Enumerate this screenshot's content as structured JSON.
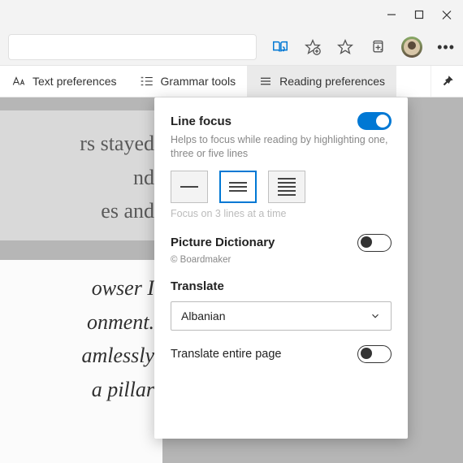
{
  "toolbar": {
    "text_preferences": "Text preferences",
    "grammar_tools": "Grammar tools",
    "reading_preferences": "Reading preferences"
  },
  "background": {
    "block1": "rs stayed\nnd\nes and",
    "block2": "owser I\nonment.\namlessly\na pillar"
  },
  "panel": {
    "line_focus": {
      "title": "Line focus",
      "help": "Helps to focus while reading by highlighting one, three or five lines",
      "hint": "Focus on 3 lines at a time",
      "enabled": true,
      "selected": 1
    },
    "picture_dictionary": {
      "title": "Picture Dictionary",
      "copyright": "© Boardmaker",
      "enabled": false
    },
    "translate": {
      "title": "Translate",
      "selected": "Albanian",
      "entire_page_label": "Translate entire page",
      "entire_page_enabled": false
    }
  }
}
